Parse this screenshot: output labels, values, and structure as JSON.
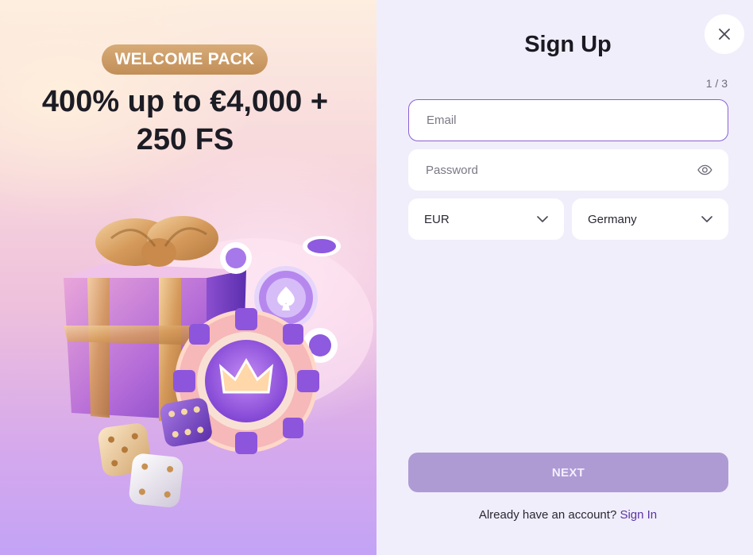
{
  "promo": {
    "badge": "WELCOME PACK",
    "title_line1": "400% up to €4,000 +",
    "title_line2": "250 FS",
    "illustration": "gift-box-chips-dice-illustration"
  },
  "form": {
    "title": "Sign Up",
    "step": "1 / 3",
    "email_placeholder": "Email",
    "password_placeholder": "Password",
    "currency": "EUR",
    "country": "Germany",
    "next_label": "NEXT",
    "signin_prompt": "Already have an account?",
    "signin_link": "Sign In"
  },
  "icons": {
    "close": "close-icon",
    "password_visibility": "eye-icon",
    "dropdown": "chevron-down-icon"
  },
  "colors": {
    "accent": "#8a5fd6",
    "next_button": "#ae9bd4",
    "link": "#5a33a6",
    "badge": "#c9955f",
    "panel_bg": "#f1eefb"
  }
}
